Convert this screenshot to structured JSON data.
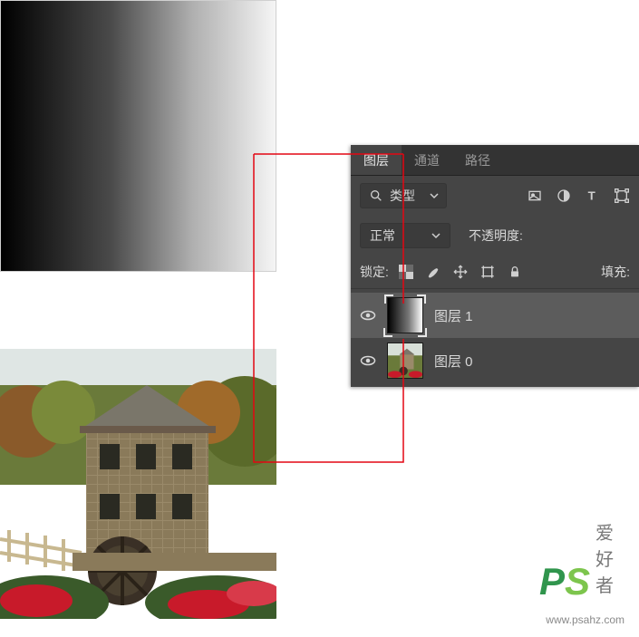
{
  "tabs": {
    "layers": "图层",
    "channels": "通道",
    "paths": "路径"
  },
  "filter": {
    "label": "类型"
  },
  "blend": {
    "mode": "正常",
    "opacity_label": "不透明度:"
  },
  "lock": {
    "label": "锁定:",
    "fill_label": "填充:"
  },
  "layers": [
    {
      "name": "图层 1"
    },
    {
      "name": "图层 0"
    }
  ],
  "watermark": {
    "p": "P",
    "s": "S",
    "text": "爱好者",
    "url": "www.psahz.com"
  }
}
